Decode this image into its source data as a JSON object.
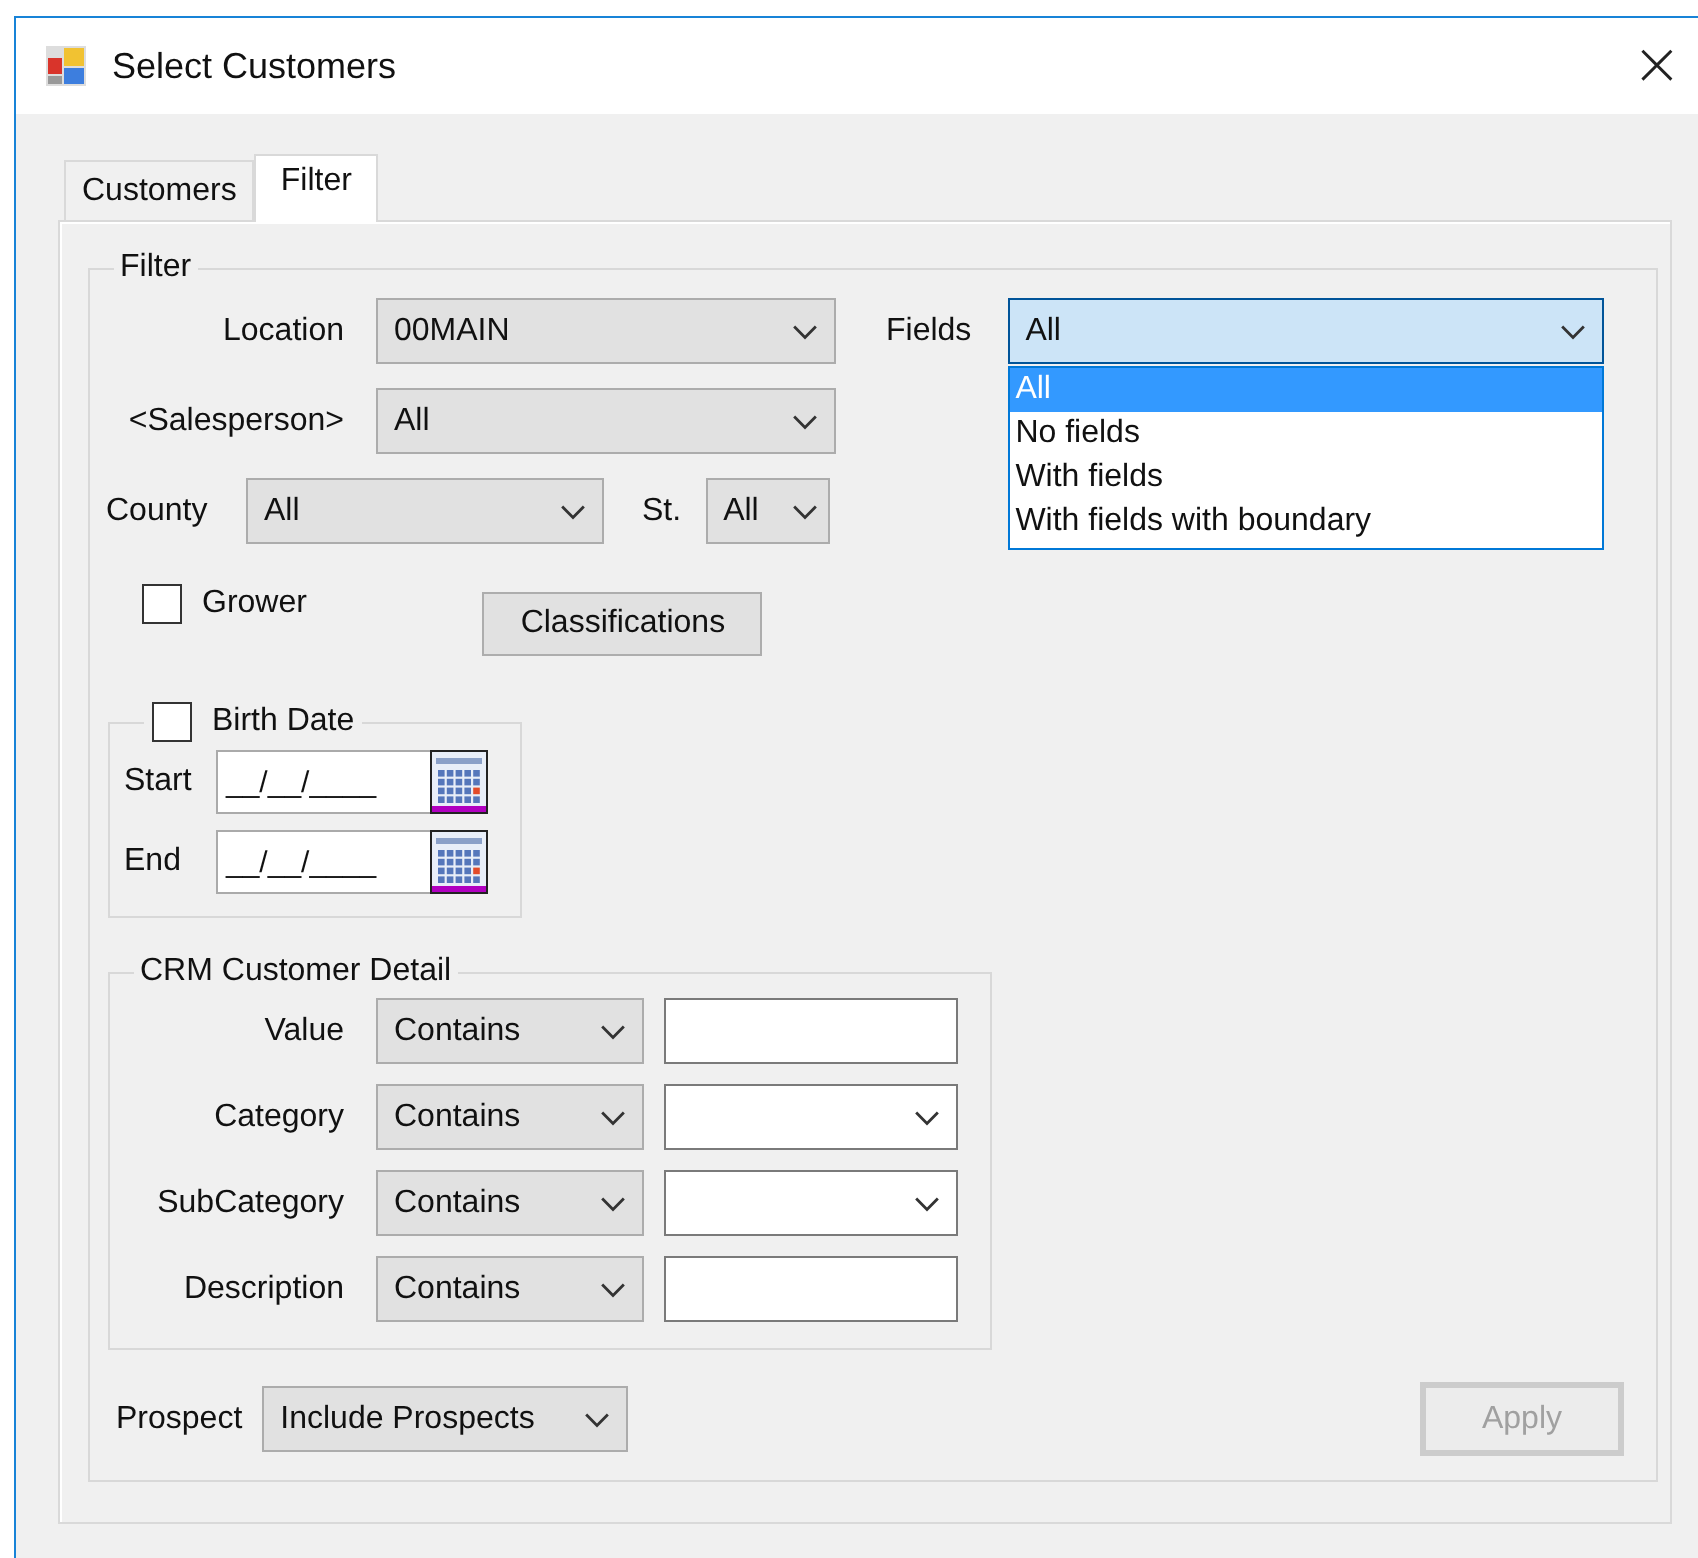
{
  "window": {
    "title": "Select Customers",
    "close": "×"
  },
  "tabs": [
    {
      "label": "Customers",
      "selected": false
    },
    {
      "label": "Filter",
      "selected": true
    }
  ],
  "filter": {
    "title": "Filter",
    "location": {
      "label": "Location",
      "value": "00MAIN"
    },
    "salesperson": {
      "label": "<Salesperson>",
      "value": "All"
    },
    "county": {
      "label": "County",
      "value": "All"
    },
    "state": {
      "label": "St.",
      "value": "All"
    },
    "fields": {
      "label": "Fields",
      "value": "All",
      "expanded": true,
      "options": [
        {
          "label": "All",
          "selected": true
        },
        {
          "label": "No fields",
          "selected": false
        },
        {
          "label": "With fields",
          "selected": false
        },
        {
          "label": "With fields with boundary",
          "selected": false
        }
      ]
    },
    "grower": {
      "label": "Grower",
      "checked": false
    },
    "classifications_button": "Classifications",
    "birth_date": {
      "label": "Birth Date",
      "checked": false,
      "start": {
        "label": "Start",
        "value": "__/__/____"
      },
      "end": {
        "label": "End",
        "value": "__/__/____"
      }
    },
    "crm": {
      "title": "CRM Customer Detail",
      "rows": [
        {
          "label": "Value",
          "operator": "Contains",
          "kind": "text"
        },
        {
          "label": "Category",
          "operator": "Contains",
          "kind": "combo"
        },
        {
          "label": "SubCategory",
          "operator": "Contains",
          "kind": "combo"
        },
        {
          "label": "Description",
          "operator": "Contains",
          "kind": "text"
        }
      ]
    },
    "prospect": {
      "label": "Prospect",
      "value": "Include Prospects"
    },
    "apply": {
      "label": "Apply",
      "disabled": true
    }
  }
}
